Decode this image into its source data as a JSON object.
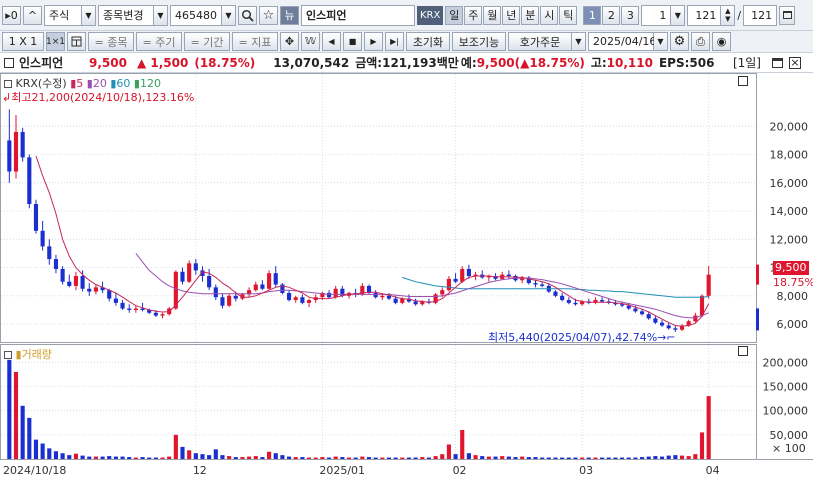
{
  "toolbar1": {
    "page_nav_label": "▸0",
    "up_label": "^",
    "market_label": "주식",
    "category_label": "종목변경",
    "code_value": "465480",
    "stock_name": "인스피언",
    "exchange_badge": "KRX",
    "periods": [
      "일",
      "주",
      "월",
      "년",
      "분",
      "시",
      "틱"
    ],
    "split_options": [
      "1",
      "2",
      "3"
    ],
    "split_value": "1",
    "count_value": "121",
    "separator": "/",
    "total_value": "121"
  },
  "toolbar2": {
    "layout_label": "1 X 1",
    "layout_alt_label": "1×1",
    "item_label": "= 종목",
    "cycle_label": "= 주기",
    "period_label": "= 기간",
    "indicator_label": "= 지표",
    "reset_label": "초기화",
    "assist_label": "보조기능",
    "order_label": "호가주문",
    "date_value": "2025/04/16"
  },
  "infobar": {
    "name": "인스피언",
    "price": "9,500",
    "change": "▲ 1,500",
    "change_pct": "(18.75%)",
    "volume": "13,070,542",
    "amount_label": "금액:121,193백만",
    "expected_label": "예:",
    "expected_value": "9,500(▲18.75%)",
    "high_label": "고:",
    "high_value": "10,110",
    "eps": "EPS:506",
    "period_tag": "[1일]"
  },
  "price_panel": {
    "legend_name": "KRX(수정)",
    "ma_labels": [
      "5",
      "20",
      "60",
      "120"
    ],
    "high_note": "최고21,200(2024/10/18),123.16%",
    "low_note": "최저5,440(2025/04/07),42.74%",
    "current_price_tag": "9,500",
    "current_pct_tag": "18.75%"
  },
  "volume_panel": {
    "legend_name": "거래량",
    "unit_note": "× 100"
  },
  "colors": {
    "up": "#e0162e",
    "down": "#1b2fd0",
    "ma5": "#c9275a",
    "ma20": "#9b4fb0",
    "ma60": "#1f8fb8",
    "ma120": "#3aa060"
  },
  "chart_data": {
    "type": "candlestick",
    "y_ticks": [
      6000,
      8000,
      10000,
      12000,
      14000,
      16000,
      18000,
      20000
    ],
    "y_tick_labels": [
      "6,000",
      "8,000",
      "10,000",
      "12,000",
      "14,000",
      "16,000",
      "18,000",
      "20,000"
    ],
    "ylim": [
      4800,
      22500
    ],
    "volume_ticks": [
      50000,
      100000,
      150000,
      200000
    ],
    "volume_tick_labels": [
      "50,000",
      "100,000",
      "150,000",
      "200,000"
    ],
    "volume_ylim": [
      0,
      215000
    ],
    "x_labels": [
      "2024/10/18",
      "12",
      "2025/01",
      "02",
      "03",
      "04"
    ],
    "x_label_index": [
      0,
      28,
      47,
      67,
      86,
      105
    ],
    "candles": [
      [
        19000,
        21200,
        16000,
        16800,
        205000
      ],
      [
        16800,
        20800,
        16300,
        19600,
        180000
      ],
      [
        19600,
        19900,
        17500,
        17800,
        110000
      ],
      [
        17800,
        18000,
        14200,
        14500,
        85000
      ],
      [
        14500,
        14800,
        12400,
        12600,
        40000
      ],
      [
        12600,
        13300,
        11200,
        11500,
        32000
      ],
      [
        11500,
        12000,
        10200,
        10600,
        22000
      ],
      [
        10600,
        10900,
        9600,
        9900,
        16000
      ],
      [
        9900,
        10100,
        8800,
        9000,
        12000
      ],
      [
        9000,
        9500,
        8600,
        8700,
        8000
      ],
      [
        8700,
        9700,
        8400,
        9400,
        11000
      ],
      [
        9400,
        9800,
        8300,
        8500,
        7000
      ],
      [
        8500,
        8900,
        8000,
        8300,
        5000
      ],
      [
        8300,
        8800,
        8100,
        8600,
        5000
      ],
      [
        8600,
        9000,
        8200,
        8400,
        5000
      ],
      [
        8400,
        8500,
        7600,
        7800,
        6000
      ],
      [
        7800,
        8200,
        7300,
        7500,
        5000
      ],
      [
        7500,
        7700,
        7000,
        7100,
        5000
      ],
      [
        7100,
        7400,
        6800,
        7000,
        4000
      ],
      [
        7000,
        7300,
        6800,
        7100,
        3000
      ],
      [
        7100,
        7500,
        6900,
        7000,
        4000
      ],
      [
        7000,
        7100,
        6700,
        6800,
        3000
      ],
      [
        6800,
        7000,
        6500,
        6600,
        3000
      ],
      [
        6600,
        6800,
        6400,
        6700,
        3000
      ],
      [
        6700,
        7200,
        6600,
        7100,
        5000
      ],
      [
        7100,
        9800,
        7000,
        9700,
        50000
      ],
      [
        9700,
        10000,
        8800,
        9000,
        25000
      ],
      [
        9000,
        10500,
        8900,
        10300,
        18000
      ],
      [
        10300,
        10600,
        9500,
        9800,
        12000
      ],
      [
        9800,
        10100,
        9000,
        9400,
        10000
      ],
      [
        9400,
        9900,
        8400,
        8600,
        8000
      ],
      [
        8600,
        8800,
        7700,
        7900,
        20000
      ],
      [
        7900,
        8200,
        7100,
        7300,
        8000
      ],
      [
        7300,
        8200,
        7200,
        8000,
        6000
      ],
      [
        8000,
        8300,
        7600,
        7800,
        4000
      ],
      [
        7800,
        8200,
        7700,
        8100,
        4000
      ],
      [
        8100,
        8600,
        7900,
        8400,
        5000
      ],
      [
        8400,
        9000,
        8300,
        8800,
        6000
      ],
      [
        8800,
        9100,
        8400,
        8500,
        4000
      ],
      [
        8500,
        9800,
        8400,
        9600,
        15000
      ],
      [
        9600,
        10100,
        8600,
        8800,
        12000
      ],
      [
        8800,
        8900,
        8100,
        8200,
        8000
      ],
      [
        8200,
        8400,
        7600,
        7700,
        5000
      ],
      [
        7700,
        8000,
        7500,
        7900,
        4000
      ],
      [
        7900,
        8100,
        7400,
        7500,
        4000
      ],
      [
        7500,
        7800,
        7200,
        7700,
        3000
      ],
      [
        7700,
        8100,
        7500,
        7900,
        3000
      ],
      [
        7900,
        8300,
        7700,
        8200,
        4000
      ],
      [
        8200,
        8400,
        7800,
        7900,
        3000
      ],
      [
        7900,
        8700,
        7800,
        8500,
        5000
      ],
      [
        8500,
        8700,
        7900,
        8000,
        4000
      ],
      [
        8000,
        8300,
        7800,
        8200,
        3000
      ],
      [
        8200,
        8500,
        7900,
        8100,
        3000
      ],
      [
        8100,
        8900,
        8000,
        8700,
        5000
      ],
      [
        8700,
        8800,
        8100,
        8200,
        4000
      ],
      [
        8200,
        8400,
        7800,
        7900,
        3000
      ],
      [
        7900,
        8200,
        7700,
        8000,
        3000
      ],
      [
        8000,
        8200,
        7700,
        7800,
        3000
      ],
      [
        7800,
        8000,
        7400,
        7500,
        3000
      ],
      [
        7500,
        7900,
        7400,
        7800,
        3000
      ],
      [
        7800,
        8100,
        7500,
        7600,
        3000
      ],
      [
        7600,
        7800,
        7300,
        7400,
        3000
      ],
      [
        7400,
        7700,
        7300,
        7600,
        4000
      ],
      [
        7600,
        7800,
        7400,
        7500,
        3000
      ],
      [
        7500,
        8200,
        7400,
        8100,
        6000
      ],
      [
        8100,
        8600,
        7900,
        8400,
        10000
      ],
      [
        8400,
        9400,
        8300,
        9200,
        30000
      ],
      [
        9200,
        9600,
        8900,
        9000,
        10000
      ],
      [
        9000,
        10100,
        8900,
        9900,
        60000
      ],
      [
        9900,
        10200,
        9200,
        9400,
        12000
      ],
      [
        9400,
        9700,
        9100,
        9500,
        8000
      ],
      [
        9500,
        9800,
        9200,
        9300,
        6000
      ],
      [
        9300,
        9500,
        9000,
        9400,
        5000
      ],
      [
        9400,
        9600,
        9100,
        9200,
        5000
      ],
      [
        9200,
        9700,
        9100,
        9500,
        6000
      ],
      [
        9500,
        9800,
        9200,
        9400,
        5000
      ],
      [
        9400,
        9500,
        9000,
        9100,
        4000
      ],
      [
        9100,
        9400,
        8900,
        9300,
        5000
      ],
      [
        9300,
        9400,
        8800,
        8900,
        4000
      ],
      [
        8900,
        9100,
        8600,
        8800,
        4000
      ],
      [
        8800,
        9000,
        8600,
        8700,
        3000
      ],
      [
        8700,
        8900,
        8200,
        8300,
        3000
      ],
      [
        8300,
        8400,
        7900,
        8000,
        3000
      ],
      [
        8000,
        8200,
        7600,
        7700,
        3000
      ],
      [
        7700,
        7900,
        7400,
        7500,
        3000
      ],
      [
        7500,
        7800,
        7300,
        7400,
        3000
      ],
      [
        7400,
        7700,
        7300,
        7600,
        3000
      ],
      [
        7600,
        7800,
        7400,
        7500,
        3000
      ],
      [
        7500,
        7900,
        7400,
        7700,
        3000
      ],
      [
        7700,
        7900,
        7500,
        7600,
        3000
      ],
      [
        7600,
        7800,
        7400,
        7500,
        3000
      ],
      [
        7500,
        7700,
        7300,
        7400,
        3000
      ],
      [
        7400,
        7600,
        7200,
        7300,
        3000
      ],
      [
        7300,
        7500,
        7000,
        7100,
        3000
      ],
      [
        7100,
        7300,
        6800,
        6900,
        3000
      ],
      [
        6900,
        7100,
        6600,
        6700,
        4000
      ],
      [
        6700,
        6900,
        6300,
        6400,
        5000
      ],
      [
        6400,
        6600,
        6000,
        6100,
        6000
      ],
      [
        6100,
        6300,
        5800,
        5900,
        5000
      ],
      [
        5900,
        6100,
        5600,
        5700,
        7000
      ],
      [
        5700,
        5900,
        5440,
        5600,
        8000
      ],
      [
        5600,
        6000,
        5500,
        5900,
        7000
      ],
      [
        5900,
        6300,
        5800,
        6200,
        6000
      ],
      [
        6200,
        6800,
        6100,
        6600,
        10000
      ],
      [
        6600,
        8100,
        6500,
        8000,
        55000
      ],
      [
        8000,
        10110,
        7800,
        9500,
        130000
      ]
    ],
    "ma": {
      "ma5": [
        null,
        null,
        null,
        null,
        17900,
        16500,
        15300,
        13800,
        12000,
        10800,
        10000,
        9500,
        9100,
        8800,
        8600,
        8400,
        8200,
        7900,
        7600,
        7300,
        7150,
        7000,
        6900,
        6850,
        6880,
        7350,
        7900,
        8500,
        9100,
        9700,
        9600,
        9300,
        8900,
        8600,
        8200,
        7900,
        7900,
        8000,
        8200,
        8400,
        8600,
        8700,
        8600,
        8400,
        8200,
        7900,
        7800,
        7800,
        7800,
        7900,
        8000,
        8100,
        8150,
        8200,
        8250,
        8250,
        8150,
        8050,
        7900,
        7800,
        7750,
        7650,
        7600,
        7550,
        7600,
        7800,
        8200,
        8600,
        9000,
        9300,
        9400,
        9400,
        9400,
        9350,
        9350,
        9350,
        9300,
        9300,
        9200,
        9100,
        9000,
        8850,
        8600,
        8300,
        8000,
        7700,
        7600,
        7550,
        7550,
        7550,
        7550,
        7500,
        7450,
        7350,
        7200,
        7050,
        6850,
        6600,
        6350,
        6100,
        5900,
        5850,
        5900,
        6050,
        6550,
        7450
      ],
      "ma20": [
        null,
        null,
        null,
        null,
        null,
        null,
        null,
        null,
        null,
        null,
        null,
        null,
        null,
        null,
        null,
        null,
        null,
        null,
        null,
        11000,
        10400,
        9800,
        9400,
        9000,
        8700,
        8500,
        8350,
        8250,
        8200,
        8150,
        8150,
        8150,
        8150,
        8150,
        8150,
        8150,
        8150,
        8150,
        8200,
        8300,
        8350,
        8400,
        8400,
        8350,
        8300,
        8250,
        8200,
        8150,
        8100,
        8100,
        8100,
        8100,
        8100,
        8100,
        8100,
        8100,
        8100,
        8100,
        8050,
        8000,
        7950,
        7950,
        7950,
        7950,
        7950,
        8000,
        8100,
        8200,
        8350,
        8500,
        8650,
        8800,
        8950,
        9050,
        9150,
        9200,
        9250,
        9250,
        9250,
        9200,
        9150,
        9050,
        8950,
        8850,
        8700,
        8550,
        8400,
        8250,
        8100,
        7950,
        7800,
        7650,
        7550,
        7450,
        7350,
        7250,
        7150,
        7050,
        6900,
        6750,
        6600,
        6500,
        6450,
        6450,
        6600,
        6800
      ],
      "ma60": [
        null,
        null,
        null,
        null,
        null,
        null,
        null,
        null,
        null,
        null,
        null,
        null,
        null,
        null,
        null,
        null,
        null,
        null,
        null,
        null,
        null,
        null,
        null,
        null,
        null,
        null,
        null,
        null,
        null,
        null,
        null,
        null,
        null,
        null,
        null,
        null,
        null,
        null,
        null,
        null,
        null,
        null,
        null,
        null,
        null,
        null,
        null,
        null,
        null,
        null,
        null,
        null,
        null,
        null,
        null,
        null,
        null,
        null,
        null,
        9300,
        9150,
        9000,
        8900,
        8800,
        8700,
        8650,
        8600,
        8550,
        8500,
        8500,
        8500,
        8500,
        8500,
        8500,
        8500,
        8500,
        8500,
        8500,
        8500,
        8500,
        8500,
        8500,
        8500,
        8500,
        8500,
        8450,
        8450,
        8400,
        8400,
        8350,
        8350,
        8300,
        8300,
        8250,
        8200,
        8150,
        8100,
        8050,
        8000,
        7950,
        7900,
        7900,
        7900,
        7900,
        7900,
        7950
      ]
    }
  }
}
